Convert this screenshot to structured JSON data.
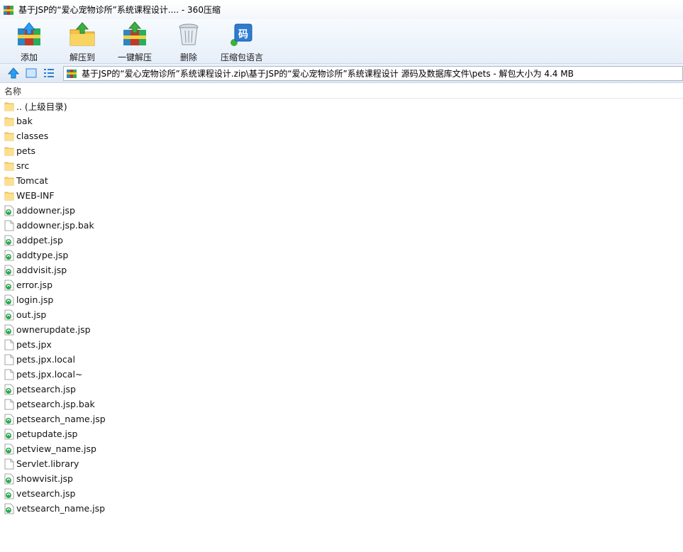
{
  "window": {
    "title": "基于JSP的“爱心宠物诊所”系统课程设计.... - 360压缩"
  },
  "toolbar": {
    "add_label": "添加",
    "extract_to_label": "解压到",
    "one_click_extract_label": "一键解压",
    "delete_label": "删除",
    "archive_language_label": "压缩包语言",
    "language_badge": "码"
  },
  "address": {
    "path": "基于JSP的“爱心宠物诊所”系统课程设计.zip\\基于JSP的“爱心宠物诊所”系统课程设计 源码及数据库文件\\pets - 解包大小为 4.4 MB"
  },
  "list": {
    "column_name": "名称",
    "items": [
      {
        "name": ".. (上级目录)",
        "type": "folder"
      },
      {
        "name": "bak",
        "type": "folder"
      },
      {
        "name": "classes",
        "type": "folder"
      },
      {
        "name": "pets",
        "type": "folder"
      },
      {
        "name": "src",
        "type": "folder"
      },
      {
        "name": "Tomcat",
        "type": "folder"
      },
      {
        "name": "WEB-INF",
        "type": "folder"
      },
      {
        "name": "addowner.jsp",
        "type": "jsp"
      },
      {
        "name": "addowner.jsp.bak",
        "type": "file"
      },
      {
        "name": "addpet.jsp",
        "type": "jsp"
      },
      {
        "name": "addtype.jsp",
        "type": "jsp"
      },
      {
        "name": "addvisit.jsp",
        "type": "jsp"
      },
      {
        "name": "error.jsp",
        "type": "jsp"
      },
      {
        "name": "login.jsp",
        "type": "jsp"
      },
      {
        "name": "out.jsp",
        "type": "jsp"
      },
      {
        "name": "ownerupdate.jsp",
        "type": "jsp"
      },
      {
        "name": "pets.jpx",
        "type": "file"
      },
      {
        "name": "pets.jpx.local",
        "type": "file"
      },
      {
        "name": "pets.jpx.local~",
        "type": "file"
      },
      {
        "name": "petsearch.jsp",
        "type": "jsp"
      },
      {
        "name": "petsearch.jsp.bak",
        "type": "file"
      },
      {
        "name": "petsearch_name.jsp",
        "type": "jsp"
      },
      {
        "name": "petupdate.jsp",
        "type": "jsp"
      },
      {
        "name": "petview_name.jsp",
        "type": "jsp"
      },
      {
        "name": "Servlet.library",
        "type": "file"
      },
      {
        "name": "showvisit.jsp",
        "type": "jsp"
      },
      {
        "name": "vetsearch.jsp",
        "type": "jsp"
      },
      {
        "name": "vetsearch_name.jsp",
        "type": "jsp"
      }
    ]
  }
}
